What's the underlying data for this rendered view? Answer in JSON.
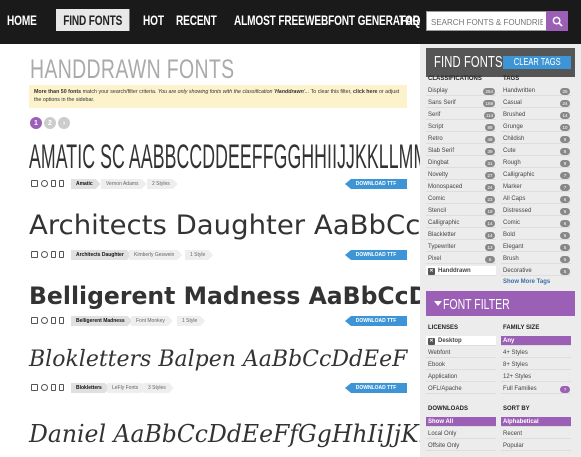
{
  "nav": {
    "items": [
      "HOME",
      "FIND FONTS",
      "HOT",
      "RECENT",
      "ALMOST FREE",
      "WEBFONT GENERATOR",
      "FAQ"
    ],
    "active": "FIND FONTS",
    "search_placeholder": "SEARCH FONTS & FOUNDRIES"
  },
  "page": {
    "title": "HANDDRAWN FONTS",
    "notice": {
      "lead": "More than 50 fonts",
      "mid1": " match your search/filter criteria. ",
      "italic": "You are only showing fonts with the classification '",
      "italic_bold": "Handdrawn",
      "italic_end": "'...",
      "tail1": " To clear this filter, ",
      "link": "click here",
      "tail2": " or adjust the options in the sidebar."
    },
    "pages": [
      "1",
      "2",
      "›"
    ]
  },
  "fonts": [
    {
      "specimen": "AMATIC SC AABBCCDDEEFFGGHHIIJJKKLLMMNNO",
      "name": "Amatic",
      "foundry": "Vernon Adams",
      "styles": "2 Styles",
      "download": "DOWNLOAD TTF"
    },
    {
      "specimen": "Architects Daughter AaBbCcDd",
      "name": "Architects Daughter",
      "foundry": "Kimberly Geswein",
      "styles": "1 Style",
      "download": "DOWNLOAD TTF"
    },
    {
      "specimen": "Belligerent Madness AaBbCcDdEe",
      "name": "Belligerent Madness",
      "foundry": "Font Monkey",
      "styles": "1 Style",
      "download": "DOWNLOAD TTF"
    },
    {
      "specimen": "Blokletters Balpen AaBbCcDdEeF",
      "name": "Blokletters",
      "foundry": "LeFly Fonts",
      "styles": "3 Styles",
      "download": "DOWNLOAD TTF"
    },
    {
      "specimen": "Daniel AaBbCcDdEeFfGgHhIiJjKkLl",
      "name": "Daniel",
      "foundry": "",
      "styles": "",
      "download": ""
    }
  ],
  "sidebar": {
    "find_fonts": "FIND FONTS",
    "clear_tags": "CLEAR TAGS",
    "classifications_head": "CLASSIFICATIONS",
    "tags_head": "TAGS",
    "classifications": [
      {
        "label": "Display",
        "count": "254"
      },
      {
        "label": "Sans Serif",
        "count": "169"
      },
      {
        "label": "Serif",
        "count": "114"
      },
      {
        "label": "Script",
        "count": "88"
      },
      {
        "label": "Retro",
        "count": "48"
      },
      {
        "label": "Slab Serif",
        "count": "39"
      },
      {
        "label": "Dingbat",
        "count": "31"
      },
      {
        "label": "Novelty",
        "count": "27"
      },
      {
        "label": "Monospaced",
        "count": "24"
      },
      {
        "label": "Comic",
        "count": "23"
      },
      {
        "label": "Stencil",
        "count": "19"
      },
      {
        "label": "Calligraphic",
        "count": "14"
      },
      {
        "label": "Blackletter",
        "count": "14"
      },
      {
        "label": "Typewriter",
        "count": "13"
      },
      {
        "label": "Pixel",
        "count": "6"
      }
    ],
    "classification_selected": "Handdrawn",
    "tags": [
      {
        "label": "Handwritten",
        "count": "26"
      },
      {
        "label": "Casual",
        "count": "24"
      },
      {
        "label": "Brushed",
        "count": "14"
      },
      {
        "label": "Grunge",
        "count": "10"
      },
      {
        "label": "Childish",
        "count": "9"
      },
      {
        "label": "Cute",
        "count": "8"
      },
      {
        "label": "Rough",
        "count": "8"
      },
      {
        "label": "Calligraphic",
        "count": "7"
      },
      {
        "label": "Marker",
        "count": "7"
      },
      {
        "label": "All Caps",
        "count": "6"
      },
      {
        "label": "Distressed",
        "count": "6"
      },
      {
        "label": "Comic",
        "count": "6"
      },
      {
        "label": "Bold",
        "count": "6"
      },
      {
        "label": "Elegant",
        "count": "5"
      },
      {
        "label": "Brush",
        "count": "5"
      },
      {
        "label": "Decorative",
        "count": "5"
      }
    ],
    "show_more_tags": "Show More Tags",
    "font_filter": "FONT FILTER",
    "licenses_head": "LICENSES",
    "family_size_head": "FAMILY SIZE",
    "licenses": [
      "Desktop",
      "Webfont",
      "Ebook",
      "Application",
      "OFL/Apache"
    ],
    "license_selected": "Desktop",
    "family_sizes": [
      "Any",
      "4+ Styles",
      "8+ Styles",
      "12+ Styles",
      "Full Families"
    ],
    "family_size_selected": "Any",
    "downloads_head": "DOWNLOADS",
    "sort_by_head": "SORT BY",
    "downloads": [
      "Show All",
      "Local Only",
      "Offsite Only"
    ],
    "downloads_selected": "Show All",
    "sort_by": [
      "Alphabetical",
      "Recent",
      "Popular"
    ],
    "sort_selected": "Alphabetical"
  },
  "colors": {
    "accent_purple": "#9b5fb5",
    "download_blue": "#3d95d6",
    "nav_bg": "#1a1a1a",
    "notice_bg": "#fcf2cc"
  }
}
